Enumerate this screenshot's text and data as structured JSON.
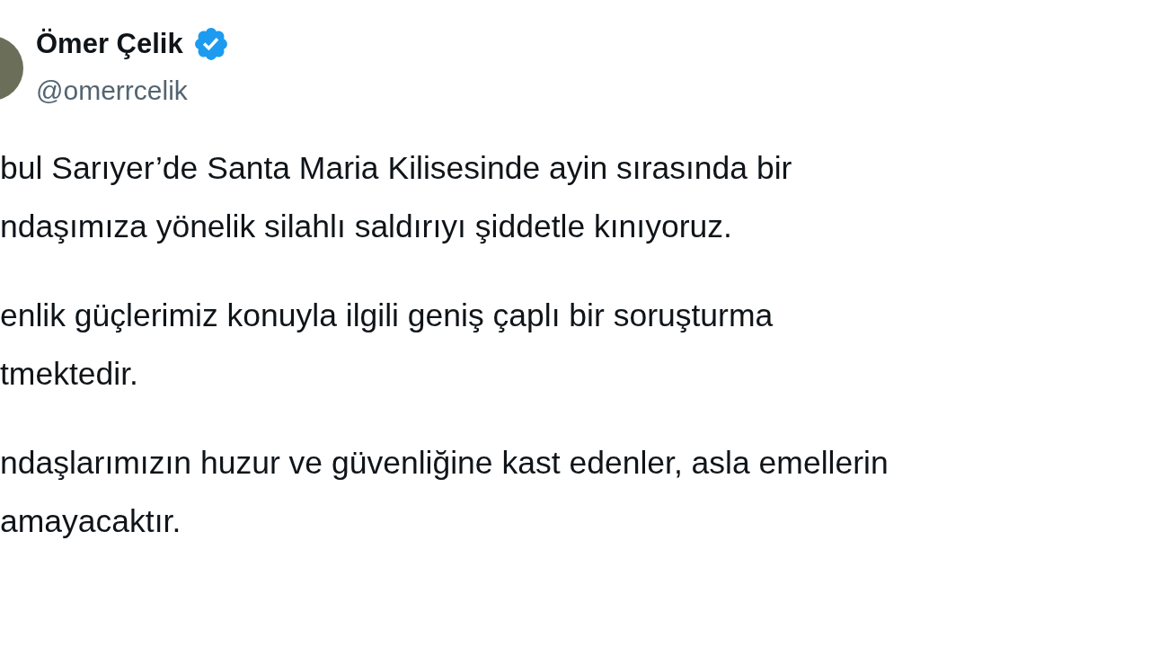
{
  "author": {
    "name": "Ömer Çelik",
    "verified": true,
    "handle": "@omerrcelik"
  },
  "paragraphs": [
    {
      "lines": [
        "bul Sarıyer’de Santa Maria Kilisesinde ayin sırasında bir",
        "ndaşımıza yönelik silahlı saldırıyı şiddetle kınıyoruz."
      ]
    },
    {
      "lines": [
        "enlik güçlerimiz konuyla ilgili geniş çaplı bir soruşturma",
        "tmektedir."
      ]
    },
    {
      "lines": [
        "ndaşlarımızın huzur ve güvenliğine kast edenler, asla emellerin",
        "amayacaktır."
      ]
    }
  ]
}
